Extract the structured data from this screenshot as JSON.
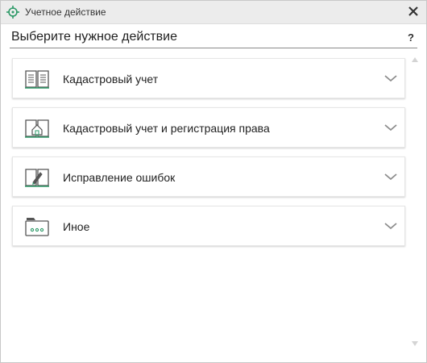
{
  "window": {
    "title": "Учетное действие"
  },
  "header": {
    "heading": "Выберите нужное действие",
    "help_label": "?"
  },
  "actions": [
    {
      "label": "Кадастровый учет",
      "icon": "open-book-icon"
    },
    {
      "label": "Кадастровый учет и регистрация права",
      "icon": "book-house-icon"
    },
    {
      "label": "Исправление ошибок",
      "icon": "book-pen-icon"
    },
    {
      "label": "Иное",
      "icon": "folder-dots-icon"
    }
  ],
  "colors": {
    "accent": "#2e9a68",
    "icon_stroke": "#555555",
    "chevron": "#8c8c8c"
  }
}
